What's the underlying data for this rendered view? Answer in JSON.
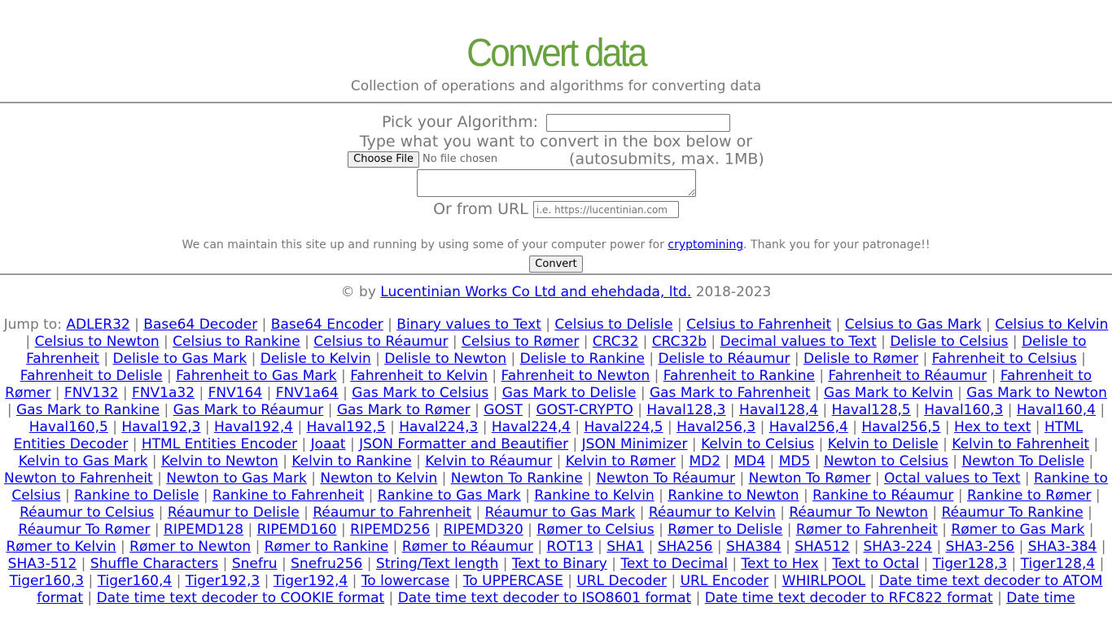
{
  "header": {
    "title": "Convert data",
    "subtitle": "Collection of operations and algorithms for converting data"
  },
  "form": {
    "algorithm_label": "Pick your Algorithm:",
    "algorithm_value": "",
    "type_hint": "Type what you want to convert in the box below or",
    "file_button_label": "Choose File",
    "file_status": "No file chosen",
    "file_hint": "(autosubmits, max. 1MB)",
    "textarea_value": "",
    "url_label": "Or from URL",
    "url_placeholder": "i.e. https://lucentinian.com",
    "url_value": "",
    "notice_before": "We can maintain this site up and running by using some of your computer power for ",
    "notice_link": "cryptomining",
    "notice_after": ". Thank you for your patronage!!",
    "convert_label": "Convert"
  },
  "footer": {
    "copyright_prefix": "© by ",
    "copyright_link": "Lucentinian Works Co Ltd and ehehdada, ltd.",
    "copyright_years": " 2018-2023"
  },
  "jump": {
    "label": "Jump to: ",
    "separator": " | ",
    "links": [
      "ADLER32",
      "Base64 Decoder",
      "Base64 Encoder",
      "Binary values to Text",
      "Celsius to Delisle",
      "Celsius to Fahrenheit",
      "Celsius to Gas Mark",
      "Celsius to Kelvin",
      "Celsius to Newton",
      "Celsius to Rankine",
      "Celsius to Réaumur",
      "Celsius to Rømer",
      "CRC32",
      "CRC32b",
      "Decimal values to Text",
      "Delisle to Celsius",
      "Delisle to Fahrenheit",
      "Delisle to Gas Mark",
      "Delisle to Kelvin",
      "Delisle to Newton",
      "Delisle to Rankine",
      "Delisle to Réaumur",
      "Delisle to Rømer",
      "Fahrenheit to Celsius",
      "Fahrenheit to Delisle",
      "Fahrenheit to Gas Mark",
      "Fahrenheit to Kelvin",
      "Fahrenheit to Newton",
      "Fahrenheit to Rankine",
      "Fahrenheit to Réaumur",
      "Fahrenheit to Rømer",
      "FNV132",
      "FNV1a32",
      "FNV164",
      "FNV1a64",
      "Gas Mark to Celsius",
      "Gas Mark to Delisle",
      "Gas Mark to Fahrenheit",
      "Gas Mark to Kelvin",
      "Gas Mark to Newton",
      "Gas Mark to Rankine",
      "Gas Mark to Réaumur",
      "Gas Mark to Rømer",
      "GOST",
      "GOST-CRYPTO",
      "Haval128,3",
      "Haval128,4",
      "Haval128,5",
      "Haval160,3",
      "Haval160,4",
      "Haval160,5",
      "Haval192,3",
      "Haval192,4",
      "Haval192,5",
      "Haval224,3",
      "Haval224,4",
      "Haval224,5",
      "Haval256,3",
      "Haval256,4",
      "Haval256,5",
      "Hex to text",
      "HTML Entities Decoder",
      "HTML Entities Encoder",
      "Joaat",
      "JSON Formatter and Beautifier",
      "JSON Minimizer",
      "Kelvin to Celsius",
      "Kelvin to Delisle",
      "Kelvin to Fahrenheit",
      "Kelvin to Gas Mark",
      "Kelvin to Newton",
      "Kelvin to Rankine",
      "Kelvin to Réaumur",
      "Kelvin to Rømer",
      "MD2",
      "MD4",
      "MD5",
      "Newton to Celsius",
      "Newton To Delisle",
      "Newton to Fahrenheit",
      "Newton to Gas Mark",
      "Newton to Kelvin",
      "Newton To Rankine",
      "Newton To Réaumur",
      "Newton To Rømer",
      "Octal values to Text",
      "Rankine to Celsius",
      "Rankine to Delisle",
      "Rankine to Fahrenheit",
      "Rankine to Gas Mark",
      "Rankine to Kelvin",
      "Rankine to Newton",
      "Rankine to Réaumur",
      "Rankine to Rømer",
      "Réaumur to Celsius",
      "Réaumur to Delisle",
      "Réaumur to Fahrenheit",
      "Réaumur to Gas Mark",
      "Réaumur to Kelvin",
      "Réaumur To Newton",
      "Réaumur To Rankine",
      "Réaumur To Rømer",
      "RIPEMD128",
      "RIPEMD160",
      "RIPEMD256",
      "RIPEMD320",
      "Rømer to Celsius",
      "Rømer to Delisle",
      "Rømer to Fahrenheit",
      "Rømer to Gas Mark",
      "Rømer to Kelvin",
      "Rømer to Newton",
      "Rømer to Rankine",
      "Rømer to Réaumur",
      "ROT13",
      "SHA1",
      "SHA256",
      "SHA384",
      "SHA512",
      "SHA3-224",
      "SHA3-256",
      "SHA3-384",
      "SHA3-512",
      "Shuffle Characters",
      "Snefru",
      "Snefru256",
      "String/Text length",
      "Text to Binary",
      "Text to Decimal",
      "Text to Hex",
      "Text to Octal",
      "Tiger128,3",
      "Tiger128,4",
      "Tiger160,3",
      "Tiger160,4",
      "Tiger192,3",
      "Tiger192,4",
      "To lowercase",
      "To UPPERCASE",
      "URL Decoder",
      "URL Encoder",
      "WHIRLPOOL",
      "Date time text decoder to ATOM format",
      "Date time text decoder to COOKIE format",
      "Date time text decoder to ISO8601 format",
      "Date time text decoder to RFC822 format",
      "Date time"
    ]
  },
  "colors": {
    "title": "#6aa13f",
    "text": "#777777",
    "link": "#0000ee"
  }
}
